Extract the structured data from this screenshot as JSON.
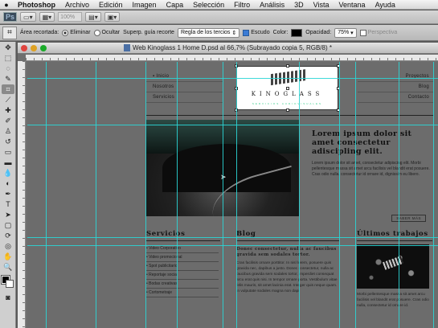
{
  "menubar": {
    "apple": "",
    "items": [
      "Photoshop",
      "Archivo",
      "Edición",
      "Imagen",
      "Capa",
      "Selección",
      "Filtro",
      "Análisis",
      "3D",
      "Vista",
      "Ventana",
      "Ayuda"
    ]
  },
  "appbar": {
    "logo": "Ps",
    "zoom": "100%"
  },
  "options": {
    "crop_area_label": "Área recortada:",
    "delete_label": "Eliminar",
    "hide_label": "Ocultar",
    "guide_overlay_label": "Superp. guía recorte",
    "guide_overlay_value": "Regla de los tercios",
    "shield_label": "Escudo",
    "color_label": "Color:",
    "shield_color": "#000000",
    "opacity_label": "Opacidad:",
    "opacity_value": "75%",
    "perspective_label": "Perspectiva"
  },
  "document": {
    "title": "Web Kinoglass 1 Home D.psd al 66,7% (Subrayado copia 5, RGB/8) *"
  },
  "site": {
    "nav_left": [
      "Inicio",
      "Nosotros",
      "Servicios"
    ],
    "nav_right": [
      "Proyectos",
      "Blog",
      "Contacto"
    ],
    "logo_word": "KINOGLASS",
    "logo_sub": "SERVICIOS AUDIOVISUALES",
    "hero_title": "Lorem ipsum dolor sit amet consectetur adiscipling elit.",
    "hero_body": "Lorem ipsum dolor sit amet, consectetur adipiscing elit. Morbi pellentesque massa sit amet arcu facilisis vel blandit erat posuere. Cras odio nulla, consectetur id ornare id, dignissim eu libero.",
    "more_label": "SABER MÁS",
    "services_title": "Servicios",
    "services": [
      "Video Corporativo",
      "Video promocional",
      "Spot publicitario",
      "Reportaje social",
      "Bodas creativas",
      "Cortometraje"
    ],
    "blog_title": "Blog",
    "blog_head": "Donec consectetur, nulla ac faucibus gravida sem sodales tortor.",
    "blog_body": "Cras facilisis ornare porttitor. In nisl lorem, posuere quis gravida nec, dapibus a justo. Donec consectetur, nulla ac faucibus gravida sem sodales tortor, imperdiet consequat arcu erat quis nisi. In tempor ornare porta. Vestibulum vitae felis mauris, sit amet lacinia erat. Integer quis neque quam. In vulputate sodales magna non dapi",
    "works_title": "Últimos trabajos",
    "works_body": "Morbi pellentesque massa sit amet arcu facilisis vel blandit erat posuere. Cras odio nulla, consectetur id ornare id."
  },
  "colors": {
    "guides": "#2bd6d6",
    "canvas": "#6c6c6c"
  }
}
